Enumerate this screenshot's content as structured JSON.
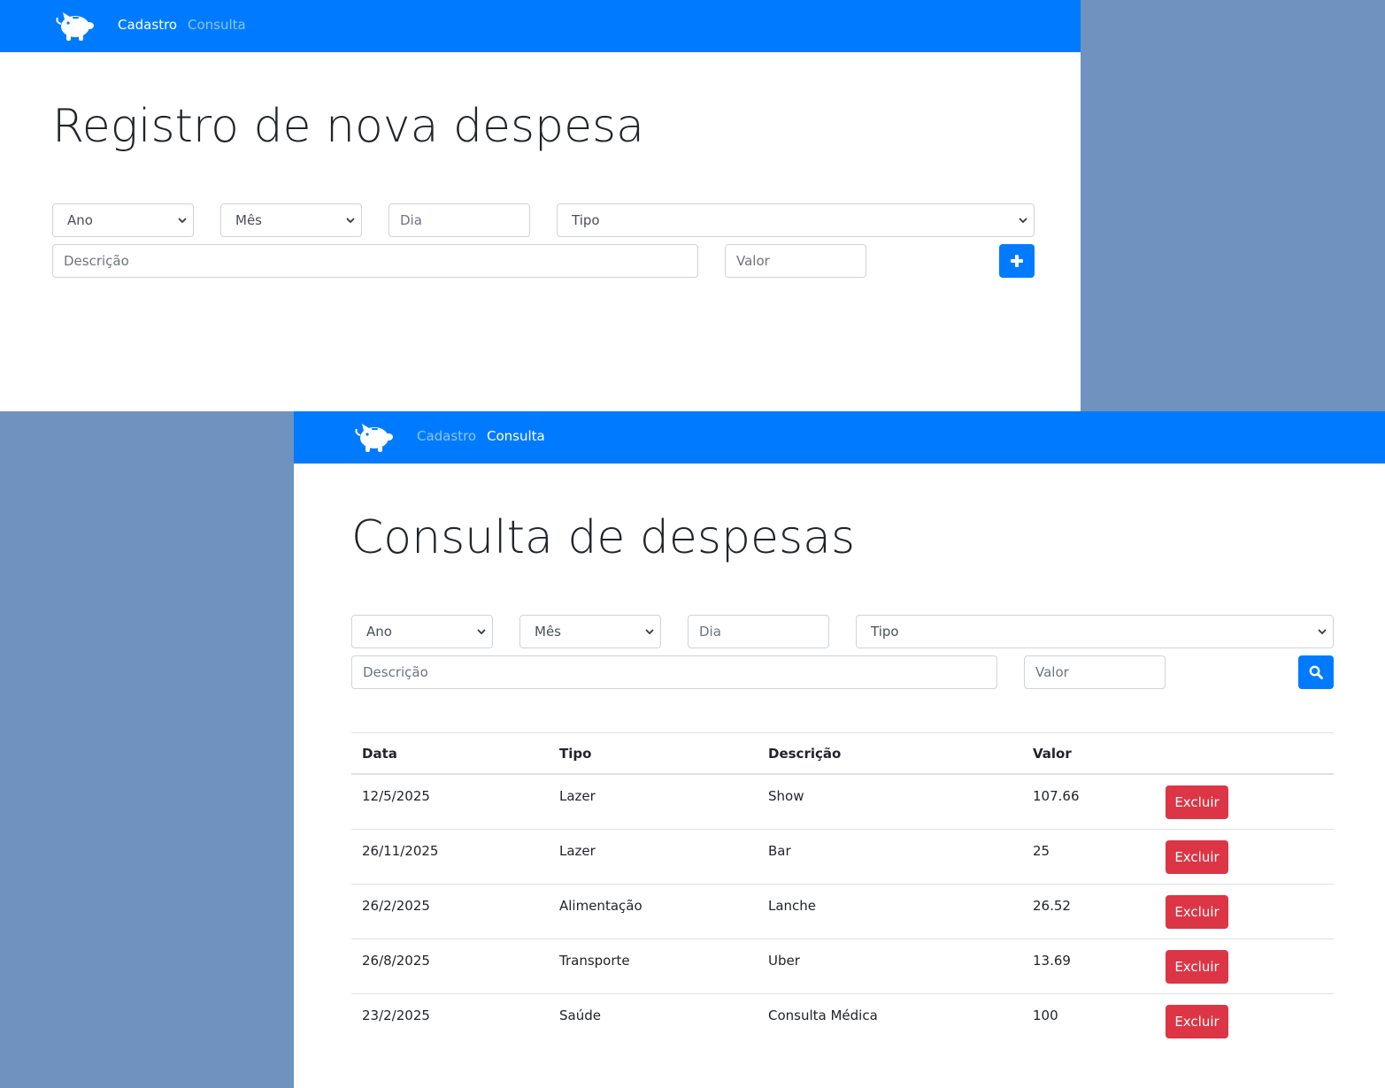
{
  "colors": {
    "primary": "#007bff",
    "danger": "#dc3545",
    "backdrop": "#7092bf"
  },
  "cadastro_window": {
    "nav": {
      "logo_icon": "piggy-bank-icon",
      "cadastro": "Cadastro",
      "consulta": "Consulta",
      "active": "Cadastro"
    },
    "title": "Registro de nova despesa",
    "form": {
      "ano": "Ano",
      "mes": "Mês",
      "dia_placeholder": "Dia",
      "tipo": "Tipo",
      "descricao_placeholder": "Descrição",
      "valor_placeholder": "Valor",
      "submit_icon": "plus-icon"
    }
  },
  "consulta_window": {
    "nav": {
      "logo_icon": "piggy-bank-icon",
      "cadastro": "Cadastro",
      "consulta": "Consulta",
      "active": "Consulta"
    },
    "title": "Consulta de despesas",
    "form": {
      "ano": "Ano",
      "mes": "Mês",
      "dia_placeholder": "Dia",
      "tipo": "Tipo",
      "descricao_placeholder": "Descrição",
      "valor_placeholder": "Valor",
      "search_icon": "search-icon"
    },
    "table": {
      "headers": [
        "Data",
        "Tipo",
        "Descrição",
        "Valor"
      ],
      "delete_label": "Excluir",
      "rows": [
        {
          "data": "12/5/2025",
          "tipo": "Lazer",
          "descricao": "Show",
          "valor": "107.66"
        },
        {
          "data": "26/11/2025",
          "tipo": "Lazer",
          "descricao": "Bar",
          "valor": "25"
        },
        {
          "data": "26/2/2025",
          "tipo": "Alimentação",
          "descricao": "Lanche",
          "valor": "26.52"
        },
        {
          "data": "26/8/2025",
          "tipo": "Transporte",
          "descricao": "Uber",
          "valor": "13.69"
        },
        {
          "data": "23/2/2025",
          "tipo": "Saúde",
          "descricao": "Consulta Médica",
          "valor": "100"
        }
      ]
    }
  }
}
